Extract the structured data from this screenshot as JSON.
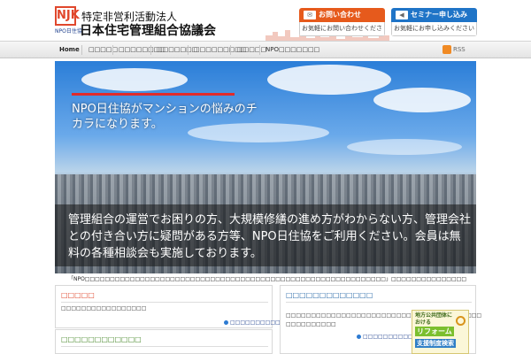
{
  "header": {
    "logo_text": "NJK",
    "logo_sub": "NPO日住協",
    "org_subtitle": "特定非営利活動法人",
    "org_name": "日本住宅管理組合協議会",
    "contact": {
      "label": "お問い合わせ",
      "sub": "お気軽にお問い合わせください"
    },
    "seminar": {
      "label": "セミナー申し込み",
      "sub": "お気軽にお申し込みください"
    }
  },
  "nav": {
    "items": [
      "Home",
      "□□□□□",
      "□□□□□□□□",
      "□□□□□□□",
      "□□□□□□□□□",
      "□□□□□",
      "NPO□□□□□□□"
    ],
    "rss": "RSS"
  },
  "hero": {
    "headline": "NPO日住協がマンションの悩みのチカラになります。",
    "description": "管理組合の運営でお困りの方、大規模修繕の進め方がわからない方、管理会社との付き合い方に疑問がある方等、NPO日住協をご利用ください。会員は無料の各種相談会も実施しております。"
  },
  "notice": "「NPO□□□□□□□□□□□□□□□□□□□□□□□□□□□□□□□□□□□□□□□□□□□□□□□□□□□□□□□□□□□□」□□□□□□□□□□□□□□□",
  "box1": {
    "title": "□□□□□",
    "text": "□□□□□□□□□□□□□□□□□",
    "link": "□□□□□□□□□□□□"
  },
  "box2": {
    "title": "□□□□□□□□□□□□"
  },
  "box3": {
    "title": "□□□□□□□□□□□□□",
    "text1": "□□□□□□□□□□□□□□□□□□□□□□□□□□□□□□□□□□□□□□□",
    "text2": "□□□□□□□□□□",
    "link": "□□□□□□□□□□□□"
  },
  "banner": {
    "line1a": "地方公共団体に",
    "line1b": "おける",
    "line2": "リフォーム",
    "line3": "支援制度検索"
  }
}
